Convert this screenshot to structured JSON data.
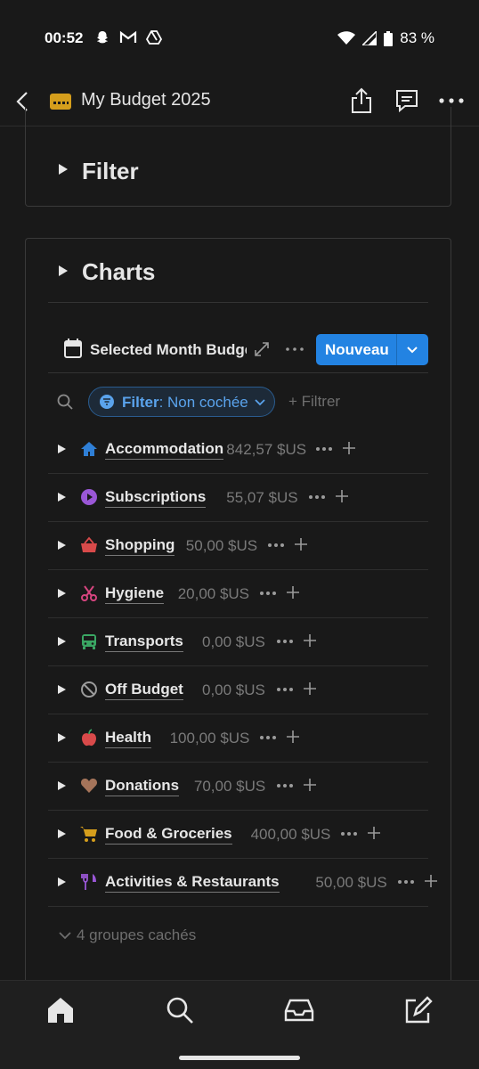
{
  "status_bar": {
    "time": "00:52",
    "battery": "83 %",
    "left_icons": [
      "snapchat-icon",
      "gmail-icon",
      "drive-icon"
    ],
    "right_icons": [
      "wifi-icon",
      "signal-icon",
      "battery-icon"
    ]
  },
  "header": {
    "title": "My Budget 2025",
    "page_icon": "credit-card-icon",
    "accent": "#d59e1c"
  },
  "filter_section": {
    "title": "Filter"
  },
  "charts_section": {
    "title": "Charts",
    "view": {
      "name": "Selected Month Budget",
      "new_button": "Nouveau"
    },
    "filter_chip": {
      "label": "Filter",
      "value": ": Non cochée"
    },
    "add_filter": "+ Filtrer",
    "groups": [
      {
        "name": "Accommodation",
        "amount": "842,57 $US",
        "icon": "house-icon",
        "color": "#2f7fd6"
      },
      {
        "name": "Subscriptions",
        "amount": "55,07 $US",
        "icon": "play-circle-icon",
        "color": "#9a57d6"
      },
      {
        "name": "Shopping",
        "amount": "50,00 $US",
        "icon": "basket-icon",
        "color": "#d84a4a"
      },
      {
        "name": "Hygiene",
        "amount": "20,00 $US",
        "icon": "scissors-icon",
        "color": "#d6457f"
      },
      {
        "name": "Transports",
        "amount": "0,00 $US",
        "icon": "bus-icon",
        "color": "#3aa663"
      },
      {
        "name": "Off Budget",
        "amount": "0,00 $US",
        "icon": "prohibited-icon",
        "color": "#9b9b9b"
      },
      {
        "name": "Health",
        "amount": "100,00 $US",
        "icon": "apple-icon",
        "color": "#d84a4a"
      },
      {
        "name": "Donations",
        "amount": "70,00 $US",
        "icon": "heart-icon",
        "color": "#a5745a"
      },
      {
        "name": "Food & Groceries",
        "amount": "400,00 $US",
        "icon": "cart-icon",
        "color": "#d59e1c"
      },
      {
        "name": "Activities & Restaurants",
        "amount": "50,00 $US",
        "icon": "fork-knife-icon",
        "color": "#9a57d6"
      }
    ],
    "hidden_groups": "4 groupes cachés"
  },
  "bottom_nav": {
    "items": [
      "home-icon",
      "search-icon",
      "inbox-icon",
      "edit-icon"
    ]
  }
}
